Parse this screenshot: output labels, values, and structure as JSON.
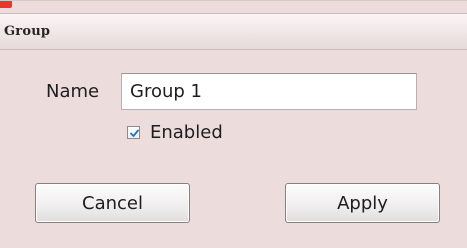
{
  "window": {
    "title": "Group"
  },
  "form": {
    "name_label": "Name",
    "name_value": "Group 1",
    "enabled_label": "Enabled",
    "enabled_checked": true
  },
  "buttons": {
    "cancel_label": "Cancel",
    "apply_label": "Apply"
  },
  "colors": {
    "window_bg": "#ecdcdc",
    "close_corner": "#e43c2c"
  }
}
